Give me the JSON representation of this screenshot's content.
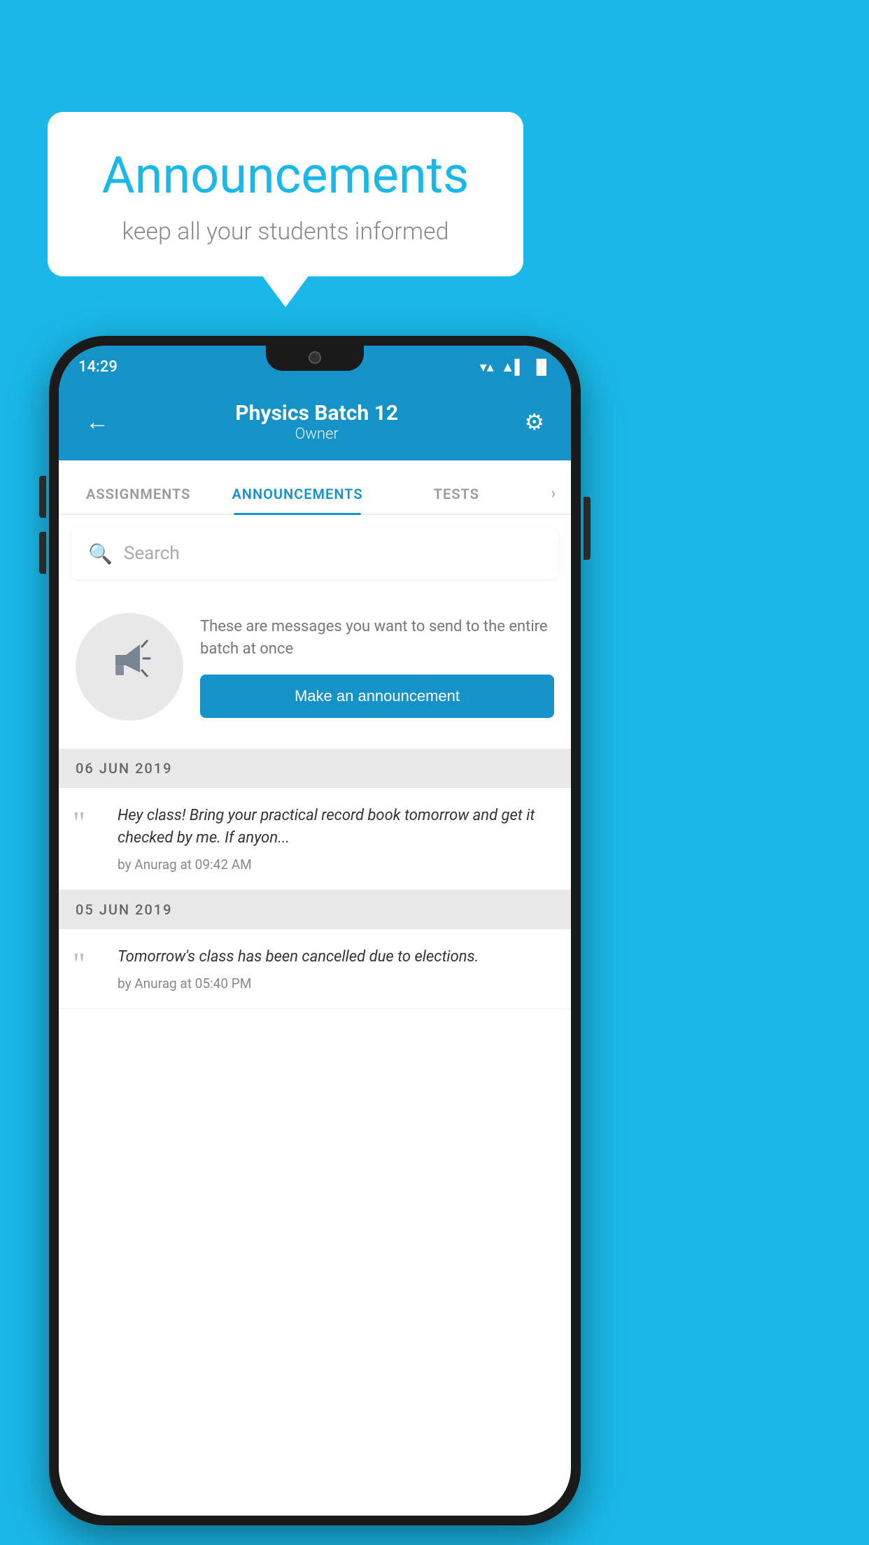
{
  "background_color": "#1ab8e8",
  "speech_bubble": {
    "title": "Announcements",
    "subtitle": "keep all your students informed"
  },
  "status_bar": {
    "time": "14:29",
    "wifi": "▼",
    "signal": "▲",
    "battery": "▐"
  },
  "app_bar": {
    "title": "Physics Batch 12",
    "subtitle": "Owner",
    "back_label": "←",
    "gear_label": "⚙"
  },
  "tabs": [
    {
      "label": "ASSIGNMENTS",
      "active": false
    },
    {
      "label": "ANNOUNCEMENTS",
      "active": true
    },
    {
      "label": "TESTS",
      "active": false
    }
  ],
  "search": {
    "placeholder": "Search"
  },
  "promo": {
    "description": "These are messages you want to send to the entire batch at once",
    "button_label": "Make an announcement"
  },
  "date_groups": [
    {
      "date": "06  JUN  2019",
      "announcements": [
        {
          "text": "Hey class! Bring your practical record book tomorrow and get it checked by me. If anyon...",
          "meta": "by Anurag at 09:42 AM"
        }
      ]
    },
    {
      "date": "05  JUN  2019",
      "announcements": [
        {
          "text": "Tomorrow's class has been cancelled due to elections.",
          "meta": "by Anurag at 05:40 PM"
        }
      ]
    }
  ]
}
